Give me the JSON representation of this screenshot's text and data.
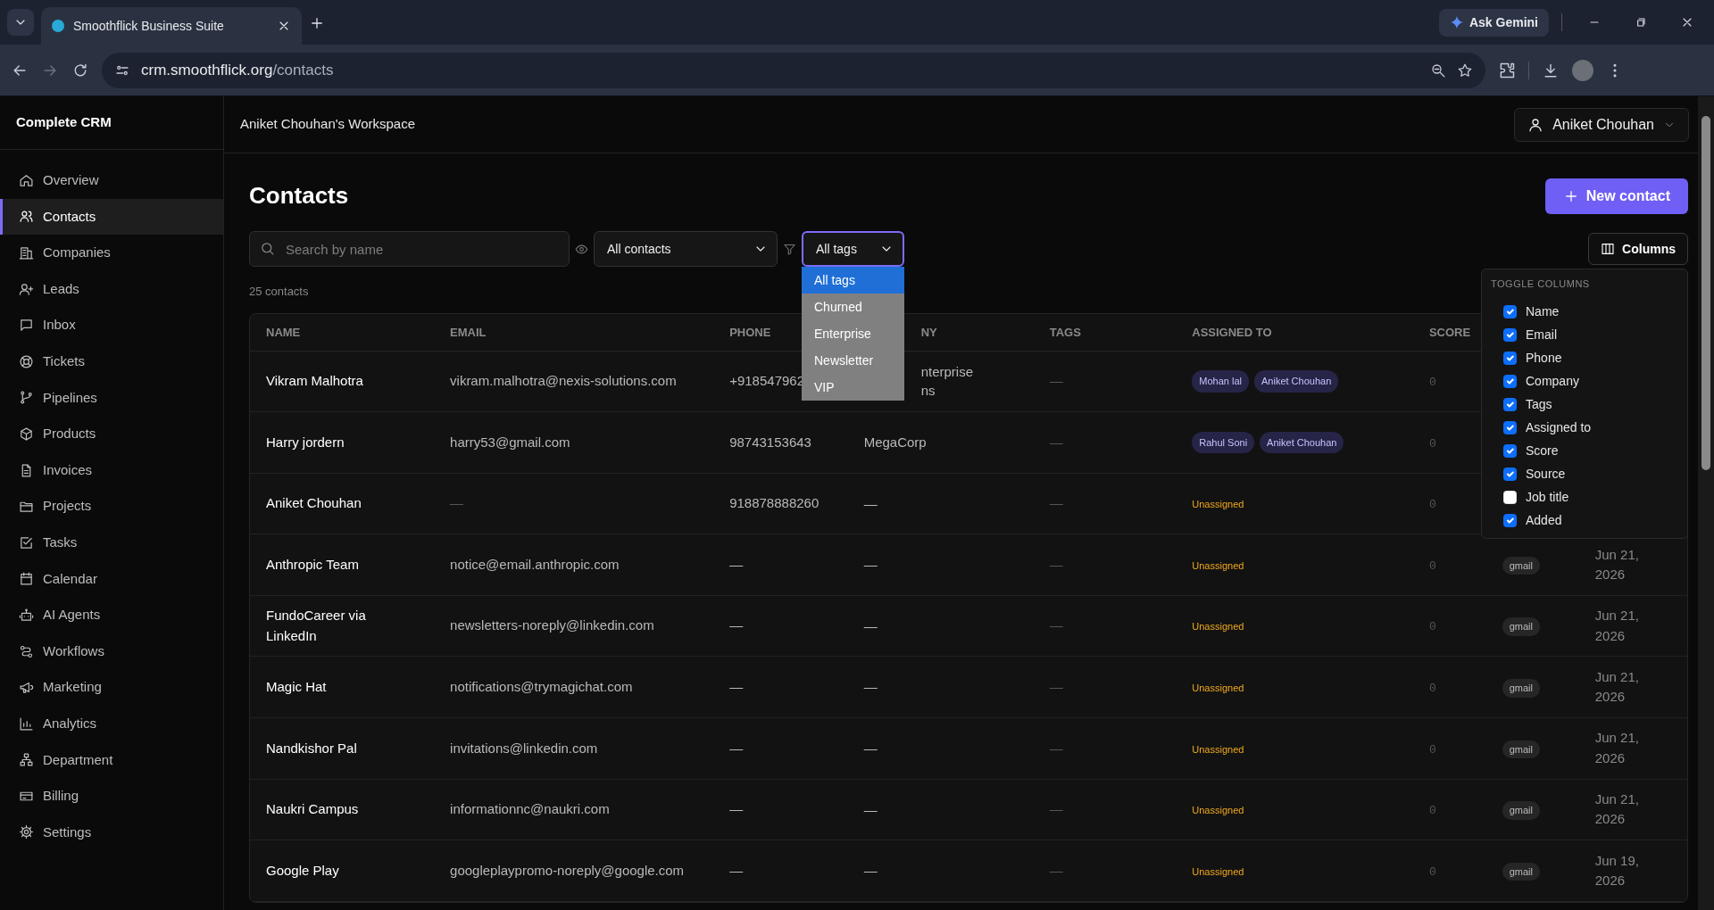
{
  "browser": {
    "tab_title": "Smoothflick Business Suite",
    "url_host": "crm.smoothflick.org",
    "url_path": "/contacts",
    "ask_button": "Ask Gemini"
  },
  "sidebar": {
    "brand": "Complete CRM",
    "items": [
      {
        "label": "Overview",
        "selected": false
      },
      {
        "label": "Contacts",
        "selected": true
      },
      {
        "label": "Companies",
        "selected": false
      },
      {
        "label": "Leads",
        "selected": false
      },
      {
        "label": "Inbox",
        "selected": false
      },
      {
        "label": "Tickets",
        "selected": false
      },
      {
        "label": "Pipelines",
        "selected": false
      },
      {
        "label": "Products",
        "selected": false
      },
      {
        "label": "Invoices",
        "selected": false
      },
      {
        "label": "Projects",
        "selected": false
      },
      {
        "label": "Tasks",
        "selected": false
      },
      {
        "label": "Calendar",
        "selected": false
      },
      {
        "label": "AI Agents",
        "selected": false
      },
      {
        "label": "Workflows",
        "selected": false
      },
      {
        "label": "Marketing",
        "selected": false
      },
      {
        "label": "Analytics",
        "selected": false
      },
      {
        "label": "Department",
        "selected": false
      },
      {
        "label": "Billing",
        "selected": false
      },
      {
        "label": "Settings",
        "selected": false
      }
    ]
  },
  "header": {
    "workspace": "Aniket Chouhan's Workspace",
    "user": "Aniket Chouhan"
  },
  "page": {
    "title": "Contacts",
    "new_button": "New contact",
    "search": {
      "placeholder": "Search by name"
    },
    "view_filter": "All contacts",
    "tag_filter": {
      "value": "All tags",
      "expanded": true,
      "options": [
        {
          "label": "All tags",
          "selected": true
        },
        {
          "label": "Churned",
          "selected": false
        },
        {
          "label": "Enterprise",
          "selected": false
        },
        {
          "label": "Newsletter",
          "selected": false
        },
        {
          "label": "VIP",
          "selected": false
        }
      ]
    },
    "columns_button": "Columns",
    "count": "25 contacts"
  },
  "columns_menu": {
    "title": "TOGGLE COLUMNS",
    "items": [
      {
        "label": "Name",
        "checked": true
      },
      {
        "label": "Email",
        "checked": true
      },
      {
        "label": "Phone",
        "checked": true
      },
      {
        "label": "Company",
        "checked": true
      },
      {
        "label": "Tags",
        "checked": true
      },
      {
        "label": "Assigned to",
        "checked": true
      },
      {
        "label": "Score",
        "checked": true
      },
      {
        "label": "Source",
        "checked": true
      },
      {
        "label": "Job title",
        "checked": false
      },
      {
        "label": "Added",
        "checked": true
      }
    ]
  },
  "table": {
    "columns": [
      "NAME",
      "EMAIL",
      "PHONE",
      "NY",
      "TAGS",
      "ASSIGNED TO",
      "SCORE"
    ],
    "rows": [
      {
        "name": "Vikram Malhotra",
        "email": "vikram.malhotra@nexis-solutions.com",
        "phone": "+918547962",
        "company": "nterprise\nns",
        "tags": "—",
        "assigned": [
          "Mohan lal",
          "Aniket Chouhan"
        ],
        "score": "0"
      },
      {
        "name": "Harry jordern",
        "email": "harry53@gmail.com",
        "phone": "98743153643",
        "company": "MegaCorp",
        "tags": "—",
        "assigned": [
          "Rahul Soni",
          "Aniket Chouhan"
        ],
        "score": "0"
      },
      {
        "name": "Aniket Chouhan",
        "email": "—",
        "phone": "918878888260",
        "company": "—",
        "tags": "—",
        "assigned": "Unassigned",
        "score": "0"
      },
      {
        "name": "Anthropic Team",
        "email": "notice@email.anthropic.com",
        "phone": "—",
        "company": "—",
        "tags": "—",
        "assigned": "Unassigned",
        "score": "0",
        "source": "gmail",
        "added": "Jun 21, 2026"
      },
      {
        "name": "FundoCareer via LinkedIn",
        "email": "newsletters-noreply@linkedin.com",
        "phone": "—",
        "company": "—",
        "tags": "—",
        "assigned": "Unassigned",
        "score": "0",
        "source": "gmail",
        "added": "Jun 21, 2026"
      },
      {
        "name": "Magic Hat",
        "email": "notifications@trymagichat.com",
        "phone": "—",
        "company": "—",
        "tags": "—",
        "assigned": "Unassigned",
        "score": "0",
        "source": "gmail",
        "added": "Jun 21, 2026"
      },
      {
        "name": "Nandkishor Pal",
        "email": "invitations@linkedin.com",
        "phone": "—",
        "company": "—",
        "tags": "—",
        "assigned": "Unassigned",
        "score": "0",
        "source": "gmail",
        "added": "Jun 21, 2026"
      },
      {
        "name": "Naukri Campus",
        "email": "informationnc@naukri.com",
        "phone": "—",
        "company": "—",
        "tags": "—",
        "assigned": "Unassigned",
        "score": "0",
        "source": "gmail",
        "added": "Jun 21, 2026"
      },
      {
        "name": "Google Play",
        "email": "googleplaypromo-noreply@google.com",
        "phone": "—",
        "company": "—",
        "tags": "—",
        "assigned": "Unassigned",
        "score": "0",
        "source": "gmail",
        "added": "Jun 19, 2026"
      }
    ]
  }
}
